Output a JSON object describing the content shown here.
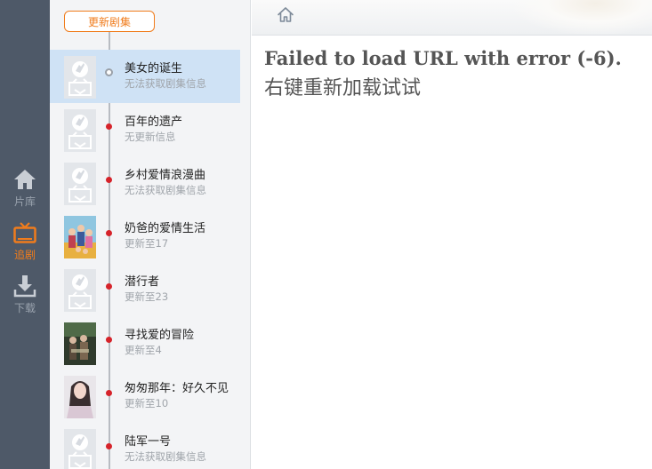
{
  "nav": {
    "items": [
      {
        "label": "片库",
        "icon": "home-icon"
      },
      {
        "label": "追剧",
        "icon": "tv-icon",
        "active": true
      },
      {
        "label": "下载",
        "icon": "download-icon"
      }
    ],
    "accent": "#f07c1c"
  },
  "list": {
    "update_button": "更新剧集",
    "items": [
      {
        "title": "美女的诞生",
        "sub": "无法获取剧集信息",
        "thumb": "placeholder",
        "selected": true
      },
      {
        "title": "百年的遗产",
        "sub": "无更新信息",
        "thumb": "placeholder"
      },
      {
        "title": "乡村爱情浪漫曲",
        "sub": "无法获取剧集信息",
        "thumb": "placeholder"
      },
      {
        "title": "奶爸的爱情生活",
        "sub": "更新至17",
        "thumb": "poster"
      },
      {
        "title": "潜行者",
        "sub": "更新至23",
        "thumb": "placeholder"
      },
      {
        "title": "寻找爱的冒险",
        "sub": "更新至4",
        "thumb": "poster"
      },
      {
        "title": "匆匆那年：好久不见",
        "sub": "更新至10",
        "thumb": "poster"
      },
      {
        "title": "陆军一号",
        "sub": "无法获取剧集信息",
        "thumb": "placeholder"
      }
    ]
  },
  "content": {
    "error_line1": "Failed to load URL with error (-6).",
    "error_line2": "右键重新加载试试"
  }
}
